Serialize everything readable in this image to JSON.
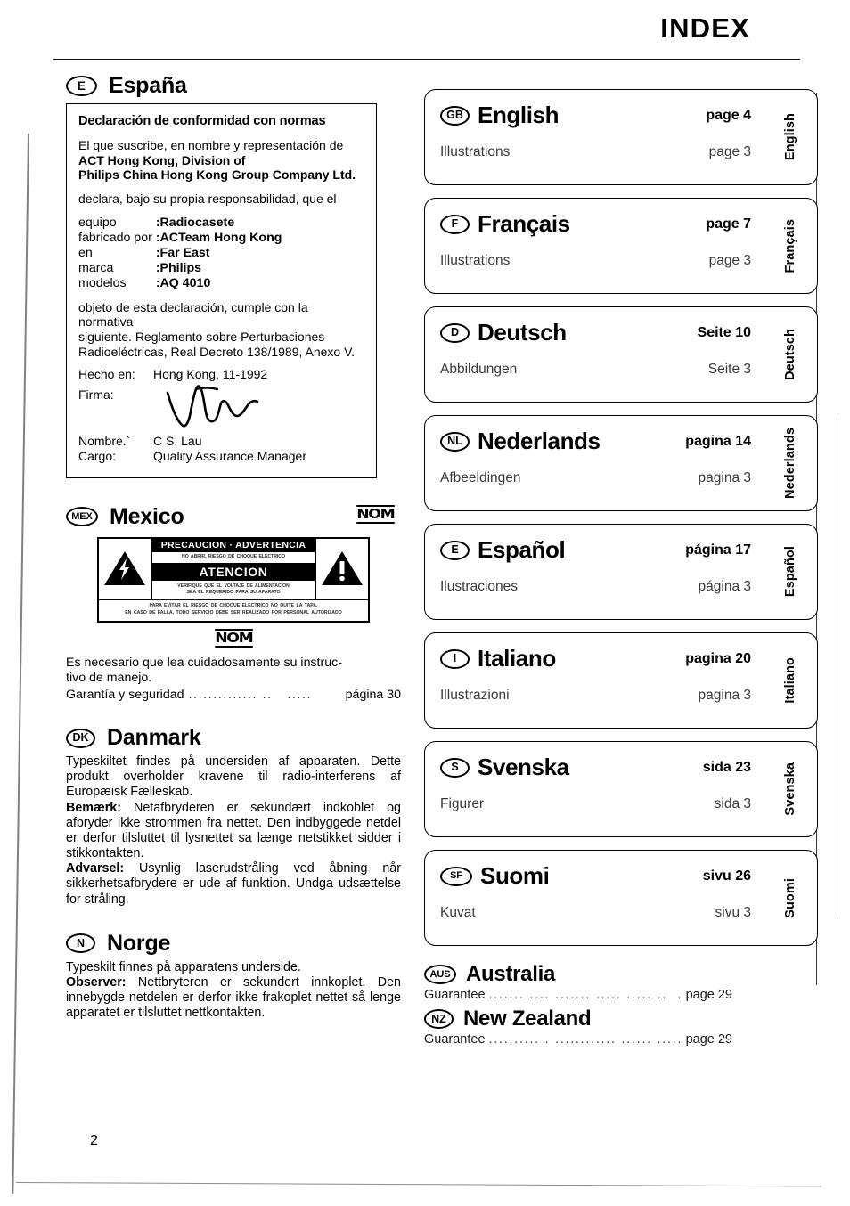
{
  "header": {
    "title": "INDEX"
  },
  "page_number": "2",
  "left_column": {
    "spain": {
      "code": "E",
      "name": "España",
      "declaration": {
        "title": "Declaración de conformidad con normas",
        "intro": "El que suscribe, en nombre y representación de",
        "company_line1": "ACT Hong Kong, Division of",
        "company_line2": "Philips China Hong Kong Group Company Ltd.",
        "declares": "declara, bajo su propia responsabilidad, que el",
        "fields": [
          {
            "key": "equipo",
            "value": "Radiocasete"
          },
          {
            "key": "fabricado por",
            "value": "ACTeam Hong Kong"
          },
          {
            "key": "en",
            "value": "Far East"
          },
          {
            "key": "marca",
            "value": "Philips"
          },
          {
            "key": "modelos",
            "value": "AQ 4010"
          }
        ],
        "regulation_line1": "objeto de esta declaración, cumple con la normativa",
        "regulation_line2": "siguiente. Reglamento sobre Perturbaciones",
        "regulation_line3": "Radioeléctricas, Real Decreto 138/1989, Anexo V.",
        "place_label": "Hecho en:",
        "place_value": "Hong Kong, 11-1992",
        "signature_label": "Firma:",
        "name_label": "Nombre.`",
        "name_value": "C  S. Lau",
        "role_label": "Cargo:",
        "role_value": "Quality Assurance Manager"
      }
    },
    "mexico": {
      "code": "MEX",
      "name": "Mexico",
      "nom_logo": "NOM",
      "warning_label": {
        "heading": "PRECAUCION · ADVERTENCIA",
        "sub_heading": "NO ABRIR, RIESGO DE CHOQUE ELECTRICO",
        "attention": "ATENCION",
        "sub_attention_line1": "VERIFIQUE QUE EL VOLTAJE DE ALIMENTACION",
        "sub_attention_line2": "SEA EL REQUERIDO PARA SU APARATO",
        "footer_line1": "PARA EVITAR EL RIESGO DE CHOQUE ELECTRICO NO QUITE LA TAPA.",
        "footer_line2": "EN CASO DE FALLA, TODO SERVICIO DEBE SER REALIZADO POR PERSONAL AUTORIZADO"
      },
      "nom_logo_bottom": "NOM",
      "note_line1": "Es necesario que lea cuidadosamente su instruc-",
      "note_line2": "tivo de manejo.",
      "guarantee_label": "Garantía y seguridad",
      "guarantee_page": "página 30"
    },
    "danmark": {
      "code": "DK",
      "name": "Danmark",
      "paragraphs": [
        {
          "lead": "",
          "text": "Typeskiltet findes på undersiden af apparaten. Dette produkt overholder kravene til radio-interferens af Europæisk Fælleskab."
        },
        {
          "lead": "Bemærk:",
          "text": " Netafbryderen er sekundært indkoblet og afbryder ikke strommen fra nettet. Den indbyggede netdel er derfor tilsluttet til lysnettet sa længe netstikket sidder i stikkontakten."
        },
        {
          "lead": "Advarsel:",
          "text": " Usynlig laserudstråling ved åbning når sikkerhetsafbrydere er ude af funktion. Undga udsættelse for stråling."
        }
      ]
    },
    "norge": {
      "code": "N",
      "name": "Norge",
      "paragraphs": [
        {
          "lead": "",
          "text": "Typeskilt finnes på apparatens underside."
        },
        {
          "lead": "Observer:",
          "text": " Nettbryteren er sekundert innkoplet. Den innebygde netdelen er derfor ikke frakoplet nettet så lenge apparatet er tilsluttet nettkontakten."
        }
      ]
    }
  },
  "right_column": {
    "languages": [
      {
        "code": "GB",
        "name": "English",
        "page_label": "page 4",
        "sub_label": "Illustrations",
        "sub_page": "page 3",
        "tab": "English"
      },
      {
        "code": "F",
        "name": "Français",
        "page_label": "page 7",
        "sub_label": "Illustrations",
        "sub_page": "page 3",
        "tab": "Français"
      },
      {
        "code": "D",
        "name": "Deutsch",
        "page_label": "Seite 10",
        "sub_label": "Abbildungen",
        "sub_page": "Seite 3",
        "tab": "Deutsch"
      },
      {
        "code": "NL",
        "name": "Nederlands",
        "page_label": "pagina 14",
        "sub_label": "Afbeeldingen",
        "sub_page": "pagina 3",
        "tab": "Nederlands"
      },
      {
        "code": "E",
        "name": "Español",
        "page_label": "página 17",
        "sub_label": "Ilustraciones",
        "sub_page": "página 3",
        "tab": "Español"
      },
      {
        "code": "I",
        "name": "Italiano",
        "page_label": "pagina 20",
        "sub_label": "Illustrazioni",
        "sub_page": "pagina 3",
        "tab": "Italiano"
      },
      {
        "code": "S",
        "name": "Svenska",
        "page_label": "sida 23",
        "sub_label": "Figurer",
        "sub_page": "sida 3",
        "tab": "Svenska"
      },
      {
        "code": "SF",
        "name": "Suomi",
        "page_label": "sivu 26",
        "sub_label": "Kuvat",
        "sub_page": "sivu 3",
        "tab": "Suomi"
      }
    ],
    "plain_entries": [
      {
        "code": "AUS",
        "name": "Australia",
        "label": "Guarantee",
        "page": "page 29"
      },
      {
        "code": "NZ",
        "name": "New Zealand",
        "label": "Guarantee",
        "page": "page 29"
      }
    ]
  }
}
